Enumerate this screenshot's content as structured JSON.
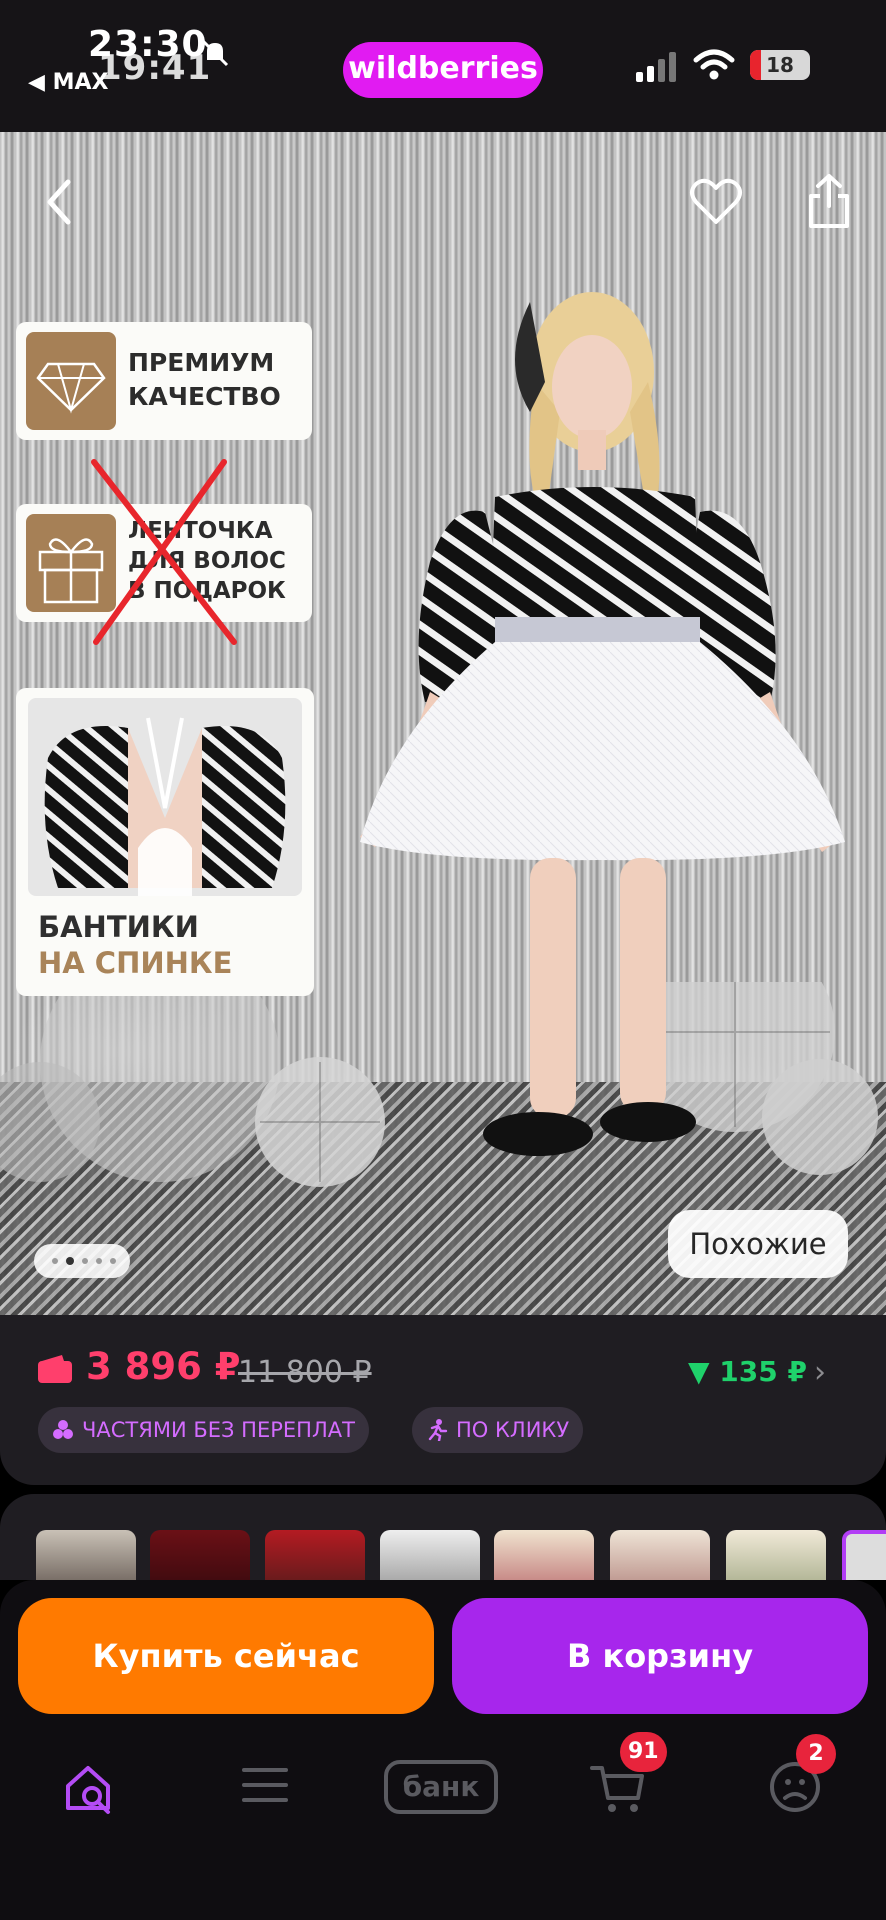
{
  "status_bar": {
    "time_primary": "23:30",
    "time_secondary": "19:41",
    "back_app": "◀ MAX",
    "battery": "18",
    "battery_level": 0.18
  },
  "app": {
    "logo": "wildberries",
    "brand_color": "#e11bf2"
  },
  "photo": {
    "badges": [
      {
        "line1": "ПРЕМИУМ",
        "line2": "КАЧЕСТВО",
        "icon": "diamond-icon"
      },
      {
        "line1": "ЛЕНТОЧКА",
        "line2": "ДЛЯ ВОЛОС",
        "line3": "В ПОДАРОК",
        "icon": "gift-icon"
      }
    ],
    "bows_line1": "БАНТИКИ",
    "bows_line2": "НА СПИНКЕ",
    "similar": "Похожие",
    "carousel_dots": 5,
    "carousel_active": 2
  },
  "price": {
    "current": "3 896 ₽",
    "old": "11 800 ₽",
    "cashback": "▼ 135 ₽",
    "current_color": "#ff3f6c",
    "cashback_color": "#1fd16b",
    "chips": [
      "ЧАСТЯМИ БЕЗ ПЕРЕПЛАТ",
      "ПО КЛИКУ"
    ]
  },
  "actions": {
    "buy_now": "Купить сейчас",
    "to_cart": "В корзину"
  },
  "nav": {
    "items": [
      {
        "name": "home",
        "icon": "home-search-icon"
      },
      {
        "name": "catalog",
        "icon": "menu-icon"
      },
      {
        "name": "bank",
        "label": "банк",
        "icon": "bank-icon"
      },
      {
        "name": "cart",
        "icon": "cart-icon",
        "badge": "91"
      },
      {
        "name": "profile",
        "icon": "profile-icon",
        "badge": "2"
      }
    ]
  }
}
